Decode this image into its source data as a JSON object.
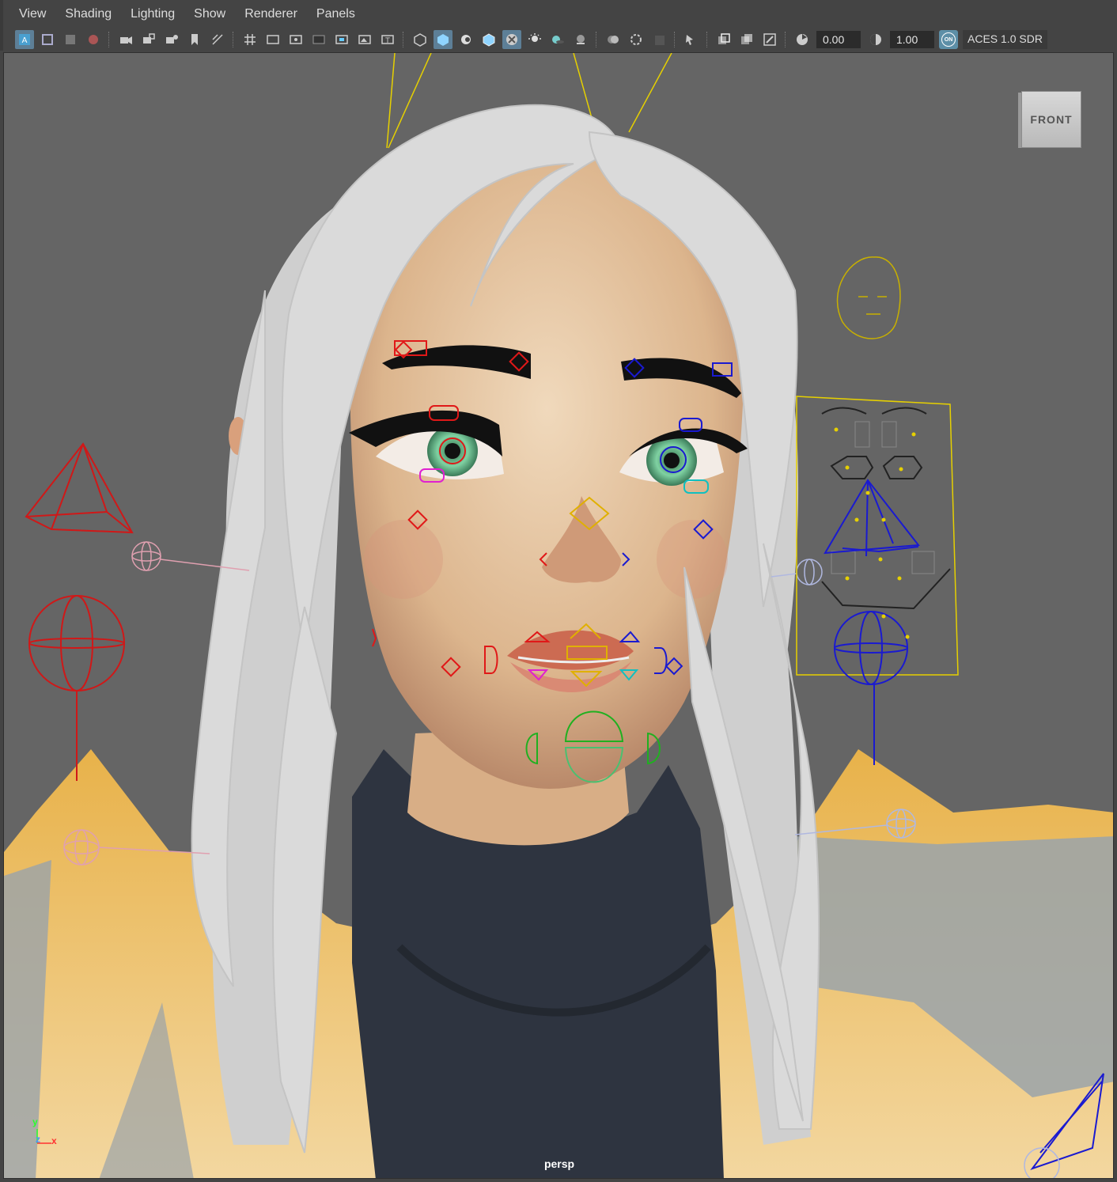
{
  "menu": {
    "items": [
      "View",
      "Shading",
      "Lighting",
      "Show",
      "Renderer",
      "Panels"
    ]
  },
  "toolbar": {
    "icons": [
      "select-camera-icon",
      "camera-attributes-icon",
      "image-plane-icon",
      "grease-pencil-icon",
      "camera-icon",
      "lock-camera-icon",
      "camera-settings-icon",
      "bookmark-icon",
      "2d-pan-zoom-icon",
      "grid-icon",
      "film-gate-icon",
      "resolution-gate-icon",
      "gate-mask-icon",
      "field-chart-icon",
      "safe-action-icon",
      "safe-title-icon",
      "wireframe-icon",
      "smooth-shade-icon",
      "default-material-icon",
      "wireframe-on-shaded-icon",
      "textured-icon",
      "use-all-lights-icon",
      "shadows-icon",
      "screen-space-ao-icon",
      "motion-blur-icon",
      "anti-aliasing-icon",
      "depth-of-field-icon",
      "isolate-select-icon",
      "xray-icon",
      "xray-joints-icon",
      "xray-components-icon",
      "exposure-icon",
      "gamma-icon"
    ],
    "exposure_value": "0.00",
    "gamma_value": "1.00",
    "color_mgmt_badge": "ON",
    "colorspace_label": "ACES 1.0 SDR"
  },
  "viewport": {
    "viewcube_label": "FRONT",
    "camera_label": "persp",
    "axis": {
      "y": "y",
      "z": "z",
      "x": "x"
    }
  },
  "colors": {
    "viewport_bg": "#656565",
    "hair": "#d9d9d9",
    "skin": "#e7c8a3",
    "jacket": "#e6ad45",
    "sweater": "#2e3440",
    "control_red": "#e01818",
    "control_blue": "#1a1ad0",
    "control_yellow": "#e0c000",
    "control_green": "#20b020"
  }
}
